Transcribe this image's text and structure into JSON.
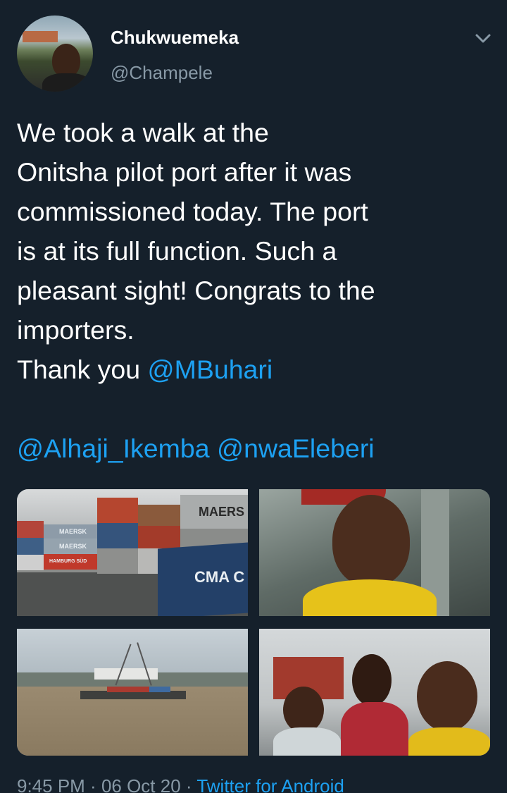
{
  "user": {
    "display_name": "Chukwuemeka",
    "handle": "@Champele",
    "avatar_icon": "profile-photo"
  },
  "menu": {
    "icon": "chevron-down-icon"
  },
  "tweet": {
    "lines": [
      "We took a walk at the",
      "Onitsha pilot port after it was",
      "commissioned today. The port",
      "is at its full function. Such a",
      "pleasant sight! Congrats to the",
      "importers."
    ],
    "thank_you_prefix": "Thank you ",
    "mention_1": "@MBuhari",
    "mention_2": "@Alhaji_Ikemba",
    "mention_3": "@nwaEleberi"
  },
  "media": {
    "photos": [
      {
        "label": "containers-yard-photo",
        "texts": [
          "MAERSK",
          "MAERSK",
          "MAERSK",
          "MAERS",
          "CMA C",
          "HAMBURG SÜD"
        ]
      },
      {
        "label": "selfie-on-barge-photo"
      },
      {
        "label": "river-port-barge-photo"
      },
      {
        "label": "group-selfie-photo"
      }
    ]
  },
  "footer": {
    "time": "9:45 PM",
    "sep": " · ",
    "date": "06 Oct 20",
    "source": "Twitter for Android"
  },
  "colors": {
    "background": "#15202b",
    "accent": "#1da1f2",
    "secondary_text": "#8899a6"
  }
}
